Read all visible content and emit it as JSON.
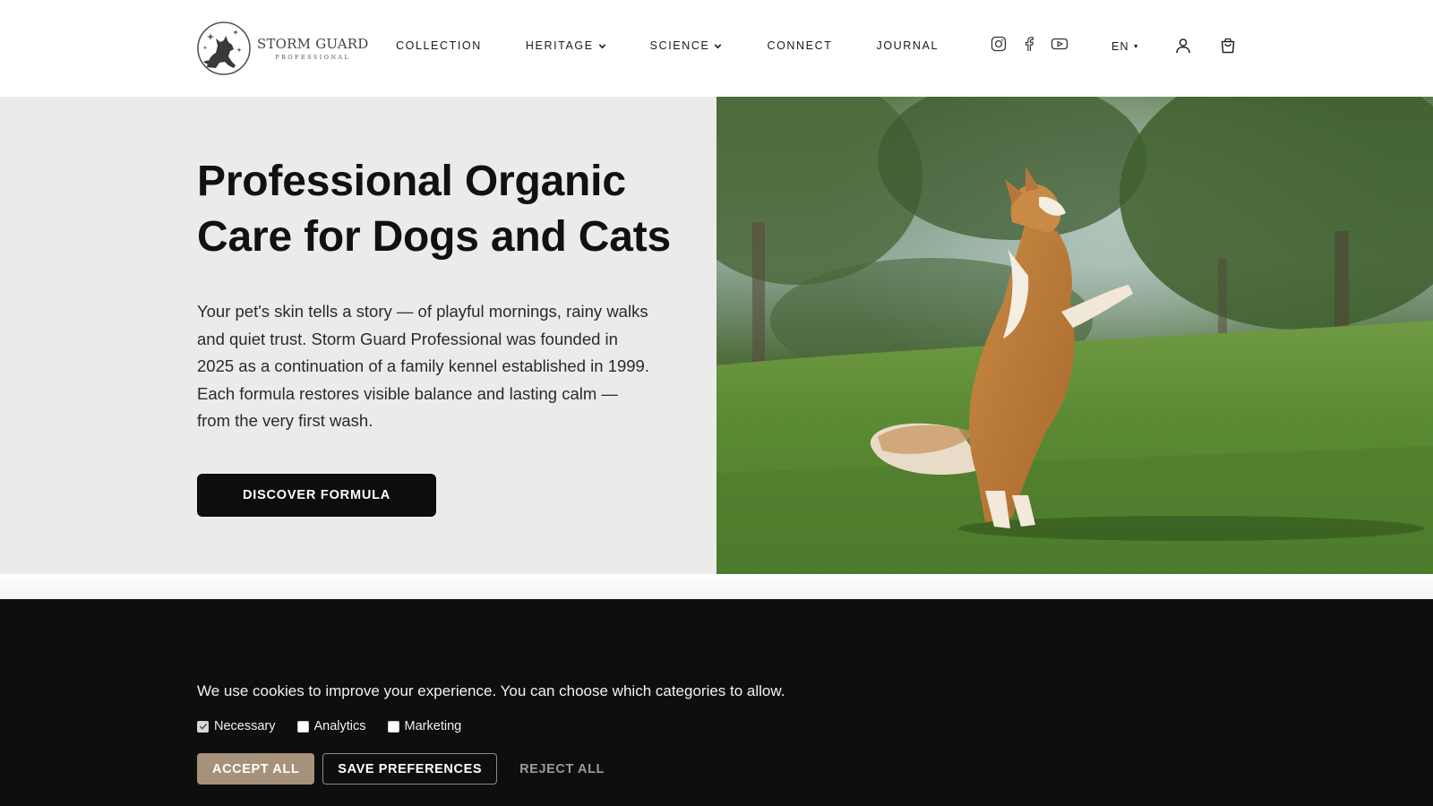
{
  "brand": {
    "name": "STORM GUARD",
    "sub": "PROFESSIONAL"
  },
  "nav": {
    "items": [
      {
        "label": "COLLECTION",
        "has_dropdown": false
      },
      {
        "label": "HERITAGE",
        "has_dropdown": true
      },
      {
        "label": "SCIENCE",
        "has_dropdown": true
      },
      {
        "label": "CONNECT",
        "has_dropdown": false
      },
      {
        "label": "JOURNAL",
        "has_dropdown": false
      }
    ]
  },
  "header": {
    "social_icons": [
      "instagram-icon",
      "facebook-icon",
      "youtube-icon"
    ],
    "language": "EN",
    "account_icon": "user-icon",
    "cart_icon": "shopping-bag-icon"
  },
  "hero": {
    "title_line1": "Professional Organic",
    "title_line2": "Care for Dogs and Cats",
    "body": "Your pet's skin tells a story — of playful mornings, rainy walks and quiet trust. Storm Guard Professional was founded in 2025 as a continuation of a family kennel established in 1999. Each formula restores visible balance and lasting calm — from the very first wash.",
    "cta": "DISCOVER FORMULA"
  },
  "cookie": {
    "message": "We use cookies to improve your experience. You can choose which categories to allow.",
    "options": [
      {
        "label": "Necessary",
        "checked": true
      },
      {
        "label": "Analytics",
        "checked": false
      },
      {
        "label": "Marketing",
        "checked": false
      }
    ],
    "accept": "ACCEPT ALL",
    "save": "SAVE PREFERENCES",
    "reject": "REJECT ALL"
  },
  "colors": {
    "hero_bg": "#ebebea",
    "cta_bg": "#0d0d0d",
    "cookie_bg": "#0e0e0e",
    "accept_bg": "#a6917a"
  }
}
